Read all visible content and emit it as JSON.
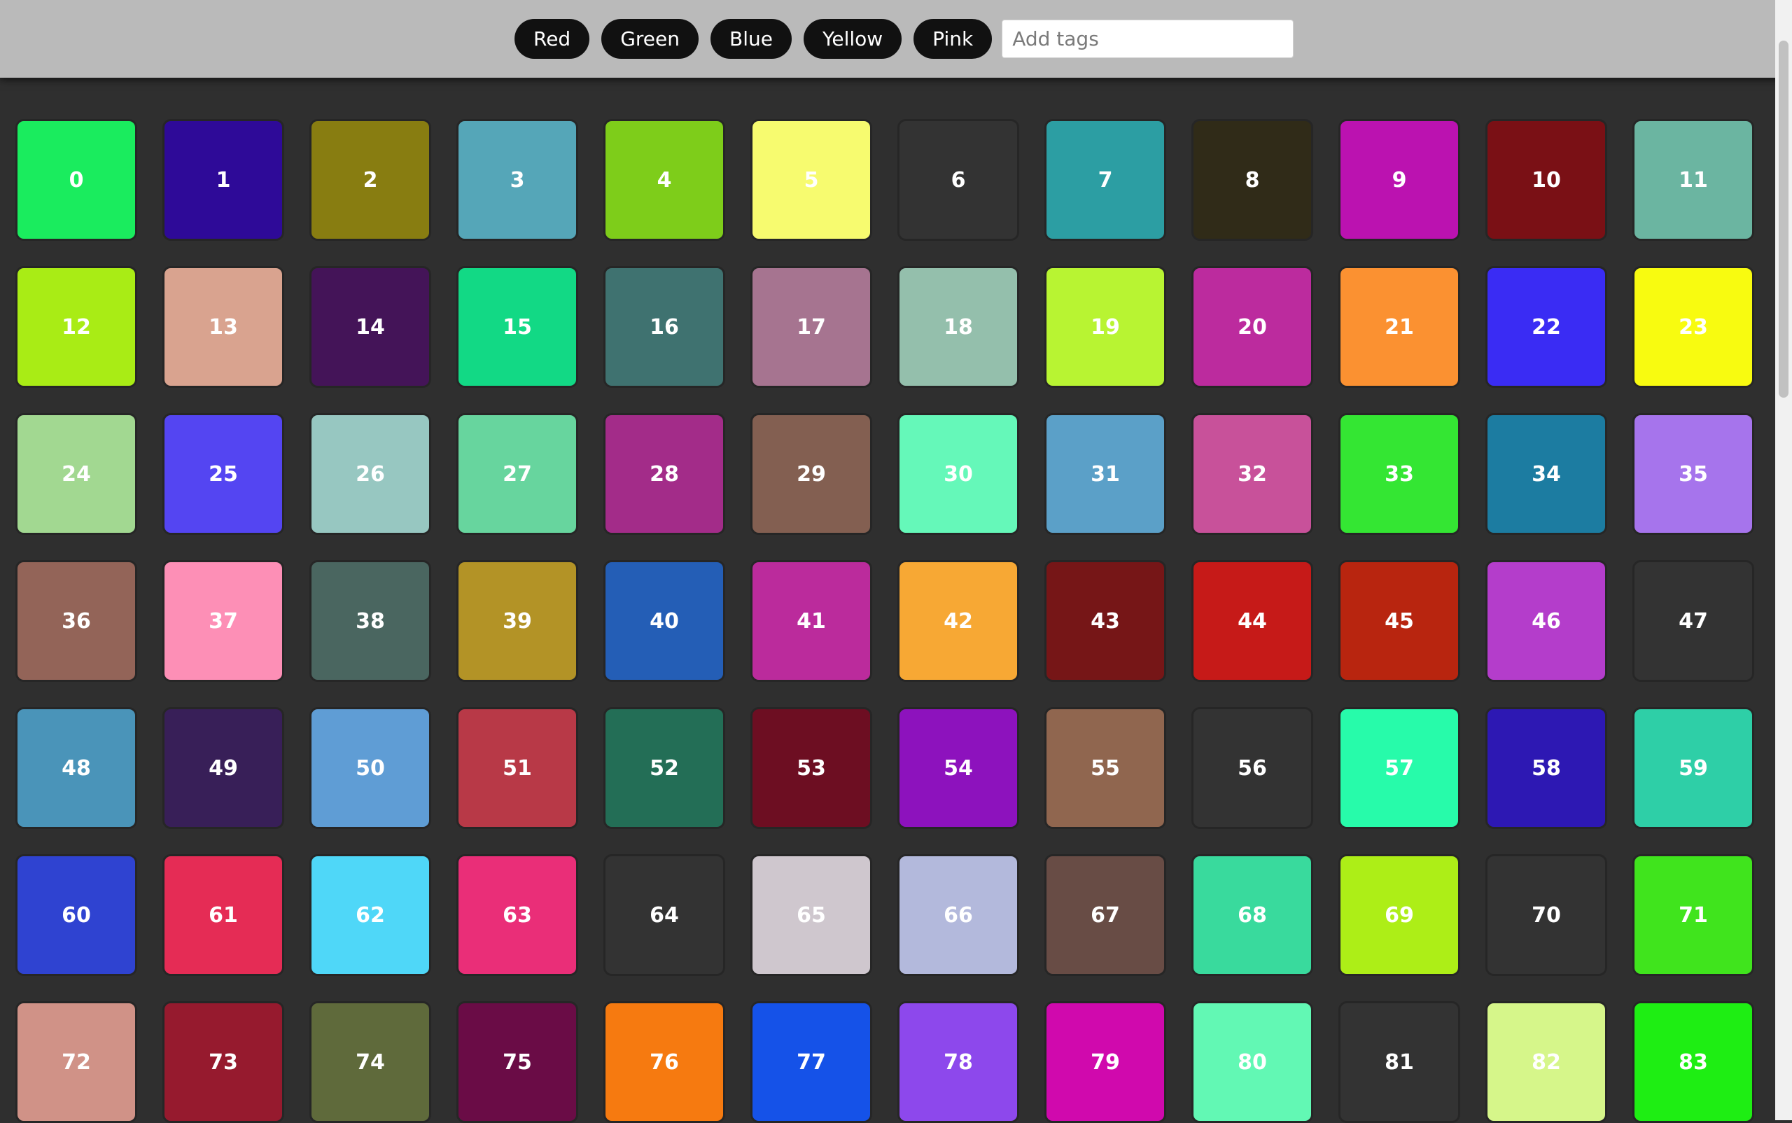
{
  "toolbar": {
    "tags": [
      {
        "label": "Red"
      },
      {
        "label": "Green"
      },
      {
        "label": "Blue"
      },
      {
        "label": "Yellow"
      },
      {
        "label": "Pink"
      }
    ],
    "input_placeholder": "Add tags"
  },
  "grid": {
    "columns": 12,
    "tiles": [
      {
        "label": "0",
        "color": "#1aec5e"
      },
      {
        "label": "1",
        "color": "#2e0a98"
      },
      {
        "label": "2",
        "color": "#887d11"
      },
      {
        "label": "3",
        "color": "#55a6b8"
      },
      {
        "label": "4",
        "color": "#7ecd1a"
      },
      {
        "label": "5",
        "color": "#f7fb6f"
      },
      {
        "label": "6",
        "color": "#333333"
      },
      {
        "label": "7",
        "color": "#2c9ea3"
      },
      {
        "label": "8",
        "color": "#302b18"
      },
      {
        "label": "9",
        "color": "#bb12b0"
      },
      {
        "label": "10",
        "color": "#7a1015"
      },
      {
        "label": "11",
        "color": "#6bb5a1"
      },
      {
        "label": "12",
        "color": "#a9ec15"
      },
      {
        "label": "13",
        "color": "#d9a38f"
      },
      {
        "label": "14",
        "color": "#441458"
      },
      {
        "label": "15",
        "color": "#12d985"
      },
      {
        "label": "16",
        "color": "#3f7270"
      },
      {
        "label": "17",
        "color": "#a67490"
      },
      {
        "label": "18",
        "color": "#94bfac"
      },
      {
        "label": "19",
        "color": "#b8f432"
      },
      {
        "label": "20",
        "color": "#bc2b9e"
      },
      {
        "label": "21",
        "color": "#fb9131"
      },
      {
        "label": "22",
        "color": "#3a2cf4"
      },
      {
        "label": "23",
        "color": "#f8fb10"
      },
      {
        "label": "24",
        "color": "#a2d891"
      },
      {
        "label": "25",
        "color": "#5445f2"
      },
      {
        "label": "26",
        "color": "#97c7c1"
      },
      {
        "label": "27",
        "color": "#67d59e"
      },
      {
        "label": "28",
        "color": "#a32c89"
      },
      {
        "label": "29",
        "color": "#835f51"
      },
      {
        "label": "30",
        "color": "#65f8b9"
      },
      {
        "label": "31",
        "color": "#5ba0c8"
      },
      {
        "label": "32",
        "color": "#c8519a"
      },
      {
        "label": "33",
        "color": "#34e633"
      },
      {
        "label": "34",
        "color": "#1c7ca1"
      },
      {
        "label": "35",
        "color": "#a674ec"
      },
      {
        "label": "36",
        "color": "#936458"
      },
      {
        "label": "37",
        "color": "#fd8fb6"
      },
      {
        "label": "38",
        "color": "#4a6660"
      },
      {
        "label": "39",
        "color": "#b39326"
      },
      {
        "label": "40",
        "color": "#245eb6"
      },
      {
        "label": "41",
        "color": "#bb2b9c"
      },
      {
        "label": "42",
        "color": "#f7a834"
      },
      {
        "label": "43",
        "color": "#761617"
      },
      {
        "label": "44",
        "color": "#c61a18"
      },
      {
        "label": "45",
        "color": "#b8250f"
      },
      {
        "label": "46",
        "color": "#b43dcb"
      },
      {
        "label": "47",
        "color": "#333333"
      },
      {
        "label": "48",
        "color": "#4a94b9"
      },
      {
        "label": "49",
        "color": "#381f58"
      },
      {
        "label": "50",
        "color": "#5f9dd5"
      },
      {
        "label": "51",
        "color": "#b83947"
      },
      {
        "label": "52",
        "color": "#236e56"
      },
      {
        "label": "53",
        "color": "#6d0e22"
      },
      {
        "label": "54",
        "color": "#8d12bd"
      },
      {
        "label": "55",
        "color": "#90664f"
      },
      {
        "label": "56",
        "color": "#333333"
      },
      {
        "label": "57",
        "color": "#27fbaa"
      },
      {
        "label": "58",
        "color": "#2d18b3"
      },
      {
        "label": "59",
        "color": "#2ecfa7"
      },
      {
        "label": "60",
        "color": "#2f43d1"
      },
      {
        "label": "61",
        "color": "#e52c55"
      },
      {
        "label": "62",
        "color": "#4fd7f8"
      },
      {
        "label": "63",
        "color": "#ea2e78"
      },
      {
        "label": "64",
        "color": "#333333"
      },
      {
        "label": "65",
        "color": "#cfc7ce"
      },
      {
        "label": "66",
        "color": "#b3b9dc"
      },
      {
        "label": "67",
        "color": "#684c45"
      },
      {
        "label": "68",
        "color": "#39da9d"
      },
      {
        "label": "69",
        "color": "#adee17"
      },
      {
        "label": "70",
        "color": "#333333"
      },
      {
        "label": "71",
        "color": "#40e41d"
      },
      {
        "label": "72",
        "color": "#d09287"
      },
      {
        "label": "73",
        "color": "#961a2e"
      },
      {
        "label": "74",
        "color": "#5f6a3b"
      },
      {
        "label": "75",
        "color": "#6a0c46"
      },
      {
        "label": "76",
        "color": "#f67a10"
      },
      {
        "label": "77",
        "color": "#1552e8"
      },
      {
        "label": "78",
        "color": "#8d48ec"
      },
      {
        "label": "79",
        "color": "#d009ad"
      },
      {
        "label": "80",
        "color": "#62f8b4"
      },
      {
        "label": "81",
        "color": "#333333"
      },
      {
        "label": "82",
        "color": "#d6f68a"
      },
      {
        "label": "83",
        "color": "#1eee13"
      }
    ]
  }
}
